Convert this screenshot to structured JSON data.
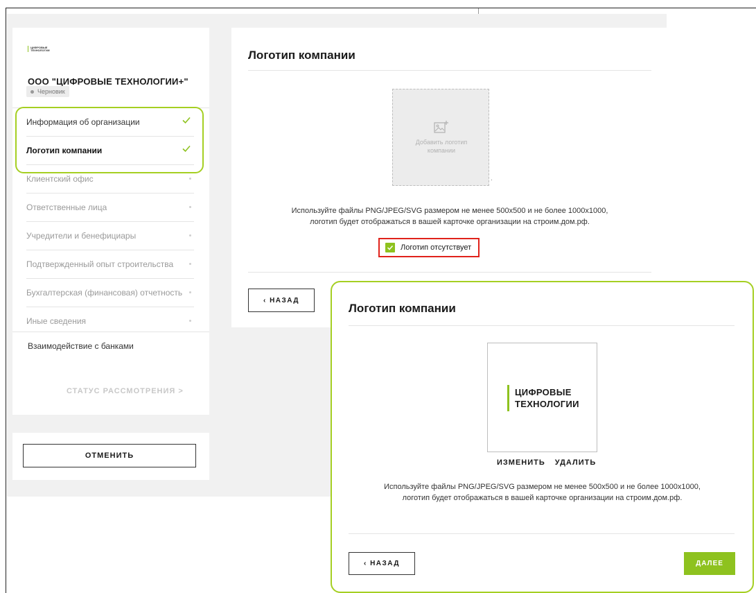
{
  "sidebar": {
    "logo_text": "ЦИФРОВЫЕ ТЕХНОЛОГИИ",
    "org_name": "ООО \"ЦИФРОВЫЕ ТЕХНОЛОГИИ+\"",
    "status_badge": "Черновик",
    "items": [
      {
        "label": "Информация об организации",
        "state": "done"
      },
      {
        "label": "Логотип компании",
        "state": "done"
      },
      {
        "label": "Клиентский офис",
        "state": "pending"
      },
      {
        "label": "Ответственные лица",
        "state": "pending"
      },
      {
        "label": "Учредители и бенефициары",
        "state": "pending"
      },
      {
        "label": "Подтвержденный опыт строительства",
        "state": "pending"
      },
      {
        "label": "Бухгалтерская (финансовая) отчетность",
        "state": "pending"
      },
      {
        "label": "Иные сведения",
        "state": "pending"
      }
    ],
    "banks_label": "Взаимодействие с банками",
    "status_link": "СТАТУС РАССМОТРЕНИЯ  >",
    "cancel_label": "ОТМЕНИТЬ"
  },
  "main": {
    "title": "Логотип компании",
    "upload_label": "Добавить логотип компании",
    "hint_line1": "Используйте файлы PNG/JPEG/SVG размером не менее 500x500 и не более 1000x1000,",
    "hint_line2": "логотип будет отображаться в вашей карточке организации на строим.дом.рф.",
    "no_logo_label": "Логотип отсутствует",
    "no_logo_checked": true,
    "back_label": "‹  НАЗАД"
  },
  "overlay": {
    "title": "Логотип компании",
    "logo_line1": "ЦИФРОВЫЕ",
    "logo_line2": "ТЕХНОЛОГИИ",
    "change_label": "ИЗМЕНИТЬ",
    "delete_label": "УДАЛИТЬ",
    "hint_line1": "Используйте файлы PNG/JPEG/SVG размером не менее 500x500 и не более 1000x1000,",
    "hint_line2": "логотип будет отображаться в вашей карточке организации на строим.дом.рф.",
    "back_label": "‹  НАЗАД",
    "next_label": "ДАЛЕЕ"
  },
  "colors": {
    "accent": "#8ec21f",
    "highlight": "#a5cf22",
    "alert": "#e0221b"
  }
}
